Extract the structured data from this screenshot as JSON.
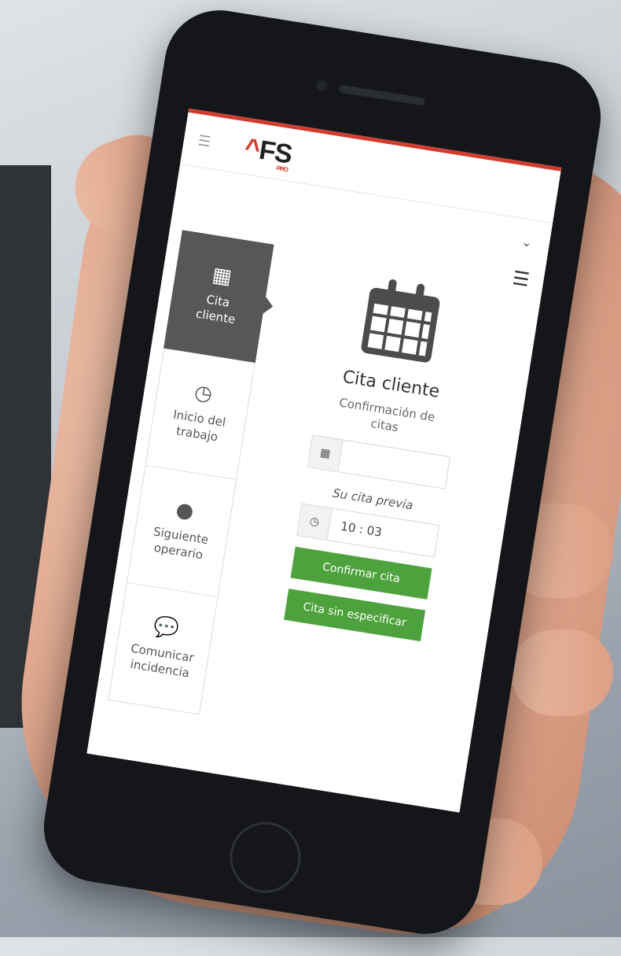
{
  "app": {
    "logo_text": "FS",
    "logo_accent": "^",
    "logo_sub": "PRO",
    "accent_color": "#d43b2f",
    "button_color": "#4ea23d"
  },
  "header": {
    "menu_icon": "hamburger-icon",
    "dropdown_icon": "chevron-down-icon",
    "main_menu_icon": "hamburger-icon"
  },
  "sidebar": {
    "items": [
      {
        "icon": "calendar-icon",
        "label_line1": "Cita",
        "label_line2": "cliente",
        "active": true
      },
      {
        "icon": "clock-icon",
        "label_line1": "Inicio del",
        "label_line2": "trabajo",
        "active": false
      },
      {
        "icon": "user-icon",
        "label_line1": "Siguiente",
        "label_line2": "operario",
        "active": false
      },
      {
        "icon": "chat-icon",
        "label_line1": "Comunicar",
        "label_line2": "incidencia",
        "active": false
      }
    ]
  },
  "main": {
    "title": "Cita cliente",
    "subtitle_line1": "Confirmación de",
    "subtitle_line2": "citas",
    "date_value": "",
    "prev_label": "Su cita previa",
    "time_value": "10 : 03",
    "confirm_button": "Confirmar cita",
    "unspecified_button": "Cita sin especificar"
  }
}
